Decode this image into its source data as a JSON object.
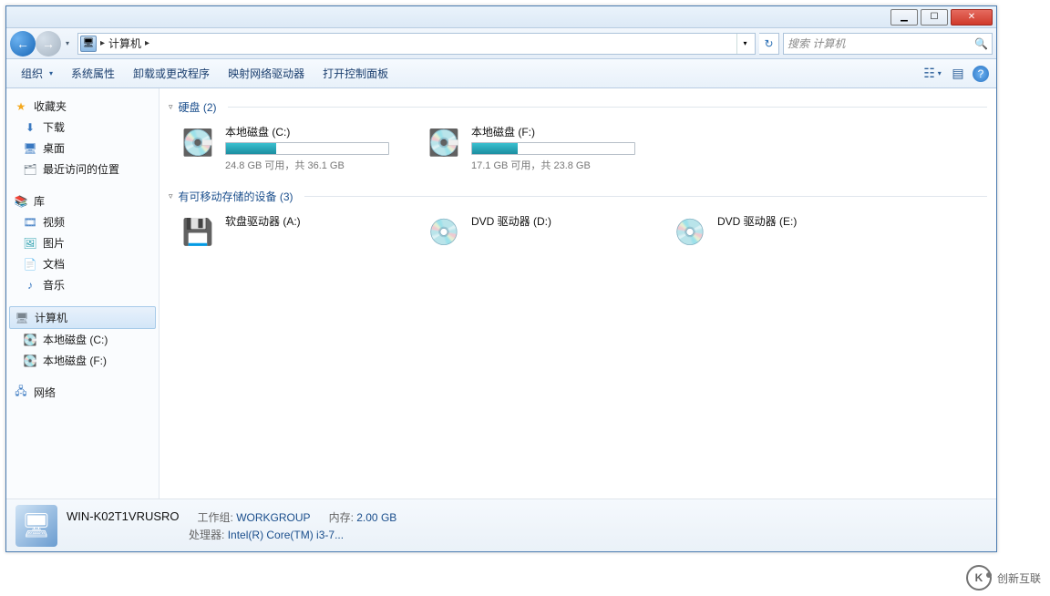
{
  "titlebar": {
    "close": "✕",
    "max": "☐",
    "min": "▁"
  },
  "nav": {
    "location_label": "计算机",
    "sep": "▸",
    "dropdown": "▾",
    "refresh": "↻",
    "search_placeholder": "搜索 计算机",
    "search_icon": "🔍"
  },
  "toolbar": {
    "organize": "组织",
    "properties": "系统属性",
    "uninstall": "卸载或更改程序",
    "map_drive": "映射网络驱动器",
    "control_panel": "打开控制面板"
  },
  "sidebar": {
    "favorites": {
      "label": "收藏夹",
      "items": [
        "下载",
        "桌面",
        "最近访问的位置"
      ]
    },
    "libraries": {
      "label": "库",
      "items": [
        "视频",
        "图片",
        "文档",
        "音乐"
      ]
    },
    "computer": {
      "label": "计算机",
      "items": [
        "本地磁盘 (C:)",
        "本地磁盘 (F:)"
      ]
    },
    "network": {
      "label": "网络"
    }
  },
  "categories": [
    {
      "title": "硬盘 (2)",
      "kind": "hdd",
      "drives": [
        {
          "name": "本地磁盘 (C:)",
          "free": "24.8 GB 可用，共 36.1 GB",
          "used_pct": 31
        },
        {
          "name": "本地磁盘 (F:)",
          "free": "17.1 GB 可用，共 23.8 GB",
          "used_pct": 28
        }
      ]
    },
    {
      "title": "有可移动存储的设备 (3)",
      "kind": "removable",
      "drives": [
        {
          "name": "软盘驱动器 (A:)",
          "icon": "floppy"
        },
        {
          "name": "DVD 驱动器 (D:)",
          "icon": "dvd"
        },
        {
          "name": "DVD 驱动器 (E:)",
          "icon": "dvd"
        }
      ]
    }
  ],
  "details": {
    "name": "WIN-K02T1VRUSRO",
    "workgroup_label": "工作组:",
    "workgroup": "WORKGROUP",
    "memory_label": "内存:",
    "memory": "2.00 GB",
    "cpu_label": "处理器:",
    "cpu": "Intel(R) Core(TM) i3-7..."
  },
  "watermark": "创新互联"
}
